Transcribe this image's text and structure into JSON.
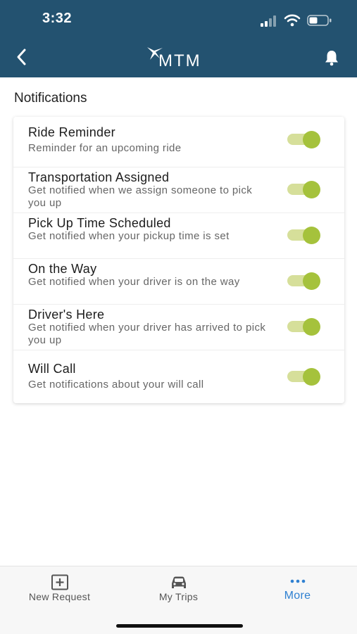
{
  "status_bar": {
    "time": "3:32"
  },
  "header": {
    "logo_text": "MTM",
    "colors": {
      "background": "#235270"
    }
  },
  "page": {
    "section_title": "Notifications"
  },
  "notifications": [
    {
      "title": "Ride Reminder",
      "description": "Reminder for an upcoming ride",
      "enabled": true
    },
    {
      "title": "Transportation Assigned",
      "description": "Get notified when we assign someone to pick you up",
      "enabled": true
    },
    {
      "title": "Pick Up Time Scheduled",
      "description": "Get notified when your pickup time is set",
      "enabled": true
    },
    {
      "title": "On the Way",
      "description": "Get notified when your driver is on the way",
      "enabled": true
    },
    {
      "title": "Driver's Here",
      "description": "Get notified when your driver has arrived to pick you up",
      "enabled": true
    },
    {
      "title": "Will Call",
      "description": "Get notifications about your will call",
      "enabled": true
    }
  ],
  "toggle_colors": {
    "track": "#d6df9a",
    "knob": "#a5c23c"
  },
  "tab_bar": {
    "tabs": [
      {
        "label": "New Request",
        "icon": "plus-square-icon",
        "active": false
      },
      {
        "label": "My Trips",
        "icon": "car-icon",
        "active": false
      },
      {
        "label": "More",
        "icon": "more-dots-icon",
        "active": true
      }
    ],
    "colors": {
      "active": "#2f80d1",
      "inactive": "#555555"
    }
  }
}
